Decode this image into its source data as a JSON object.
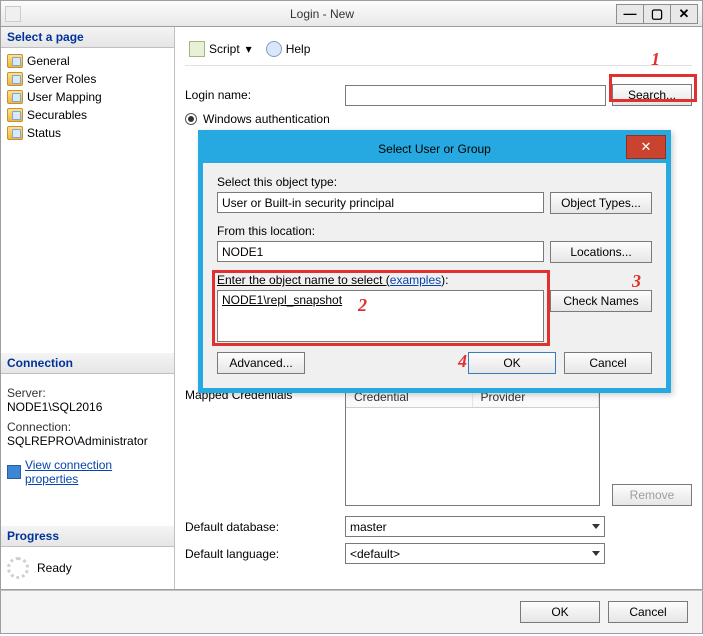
{
  "window": {
    "title": "Login - New",
    "min": "—",
    "max": "▢",
    "close": "✕"
  },
  "left": {
    "select_page": "Select a page",
    "pages": [
      "General",
      "Server Roles",
      "User Mapping",
      "Securables",
      "Status"
    ],
    "connection_hd": "Connection",
    "server_lbl": "Server:",
    "server_val": "NODE1\\SQL2016",
    "conn_lbl": "Connection:",
    "conn_val": "SQLREPRO\\Administrator",
    "view_conn": "View connection properties",
    "progress_hd": "Progress",
    "ready": "Ready"
  },
  "toolbar": {
    "script": "Script",
    "help": "Help"
  },
  "form": {
    "login_name_lbl": "Login name:",
    "search_btn": "Search...",
    "win_auth": "Windows authentication",
    "mapped_cred": "Mapped Credentials",
    "col_credential": "Credential",
    "col_provider": "Provider",
    "remove": "Remove",
    "def_db_lbl": "Default database:",
    "def_db_val": "master",
    "def_lang_lbl": "Default language:",
    "def_lang_val": "<default>"
  },
  "footer": {
    "ok": "OK",
    "cancel": "Cancel"
  },
  "modal": {
    "title": "Select User or Group",
    "close": "✕",
    "obj_type_lbl": "Select this object type:",
    "obj_type_val": "User or Built-in security principal",
    "obj_types_btn": "Object Types...",
    "location_lbl": "From this location:",
    "location_val": "NODE1",
    "locations_btn": "Locations...",
    "enter_name_lbl": "Enter the object name to select (",
    "examples": "examples",
    "enter_name_lbl2": "):",
    "name_val": "NODE1\\repl_snapshot",
    "check_names": "Check Names",
    "advanced": "Advanced...",
    "ok": "OK",
    "cancel": "Cancel"
  },
  "annotations": {
    "a1": "1",
    "a2": "2",
    "a3": "3",
    "a4": "4"
  }
}
